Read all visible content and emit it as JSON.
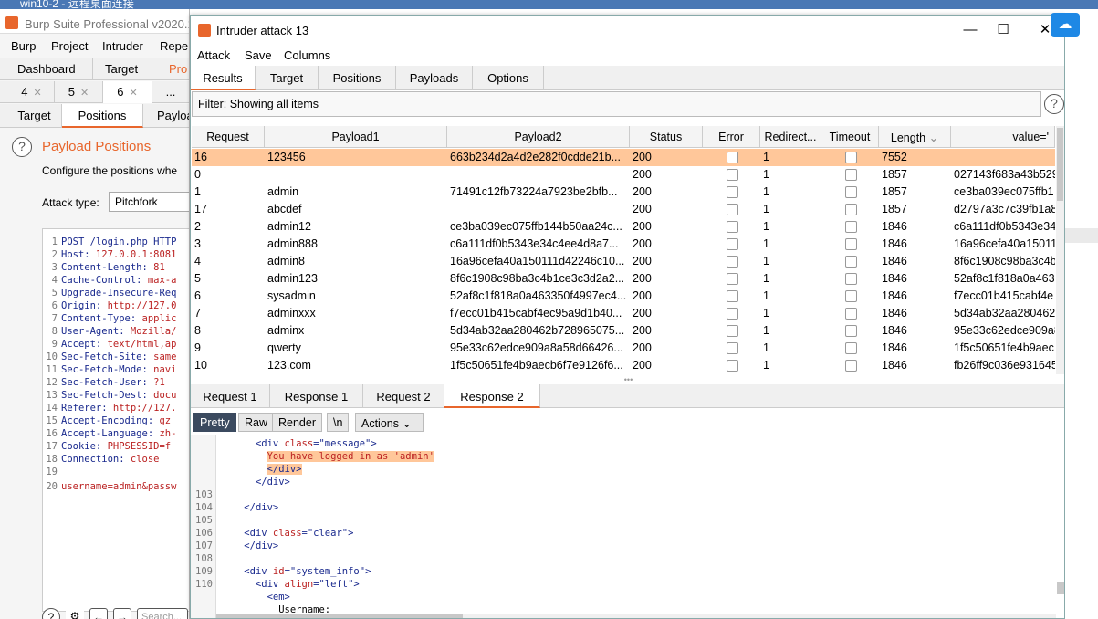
{
  "rdp": {
    "title": "win10-2 - 远程桌面连接"
  },
  "burp": {
    "title": "Burp Suite Professional v2020.1",
    "menu": [
      "Burp",
      "Project",
      "Intruder",
      "Repe"
    ],
    "top_tabs": [
      "Dashboard",
      "Target",
      "Pro"
    ],
    "num_tabs": [
      "4",
      "5",
      "6",
      "..."
    ],
    "sub_tabs": [
      "Target",
      "Positions",
      "Payloa"
    ],
    "positions_title": "Payload Positions",
    "positions_desc": "Configure the positions whe",
    "attack_type_label": "Attack type:",
    "attack_type_value": "Pitchfork",
    "request_lines": [
      {
        "n": "1",
        "key": "POST /login.php HTTP",
        "val": ""
      },
      {
        "n": "2",
        "key": "Host:",
        "val": " 127.0.0.1:8081"
      },
      {
        "n": "3",
        "key": "Content-Length:",
        "val": " 81"
      },
      {
        "n": "4",
        "key": "Cache-Control:",
        "val": " max-a"
      },
      {
        "n": "5",
        "key": "Upgrade-Insecure-Req",
        "val": ""
      },
      {
        "n": "6",
        "key": "Origin:",
        "val": " http://127.0"
      },
      {
        "n": "7",
        "key": "Content-Type:",
        "val": " applic"
      },
      {
        "n": "8",
        "key": "User-Agent:",
        "val": " Mozilla/"
      },
      {
        "n": "9",
        "key": "Accept:",
        "val": " text/html,ap"
      },
      {
        "n": "10",
        "key": "Sec-Fetch-Site:",
        "val": " same"
      },
      {
        "n": "11",
        "key": "Sec-Fetch-Mode:",
        "val": " navi"
      },
      {
        "n": "12",
        "key": "Sec-Fetch-User:",
        "val": " ?1"
      },
      {
        "n": "13",
        "key": "Sec-Fetch-Dest:",
        "val": " docu"
      },
      {
        "n": "14",
        "key": "Referer:",
        "val": " http://127."
      },
      {
        "n": "15",
        "key": "Accept-Encoding:",
        "val": " gz"
      },
      {
        "n": "16",
        "key": "Accept-Language:",
        "val": " zh-"
      },
      {
        "n": "17",
        "key": "Cookie:",
        "val": " PHPSESSID=f"
      },
      {
        "n": "18",
        "key": "Connection:",
        "val": " close"
      },
      {
        "n": "19",
        "key": "",
        "val": ""
      },
      {
        "n": "20",
        "key": "username=admin&passw",
        "val": ""
      }
    ],
    "search_placeholder": "Search..."
  },
  "window": {
    "title": "Intruder attack 13",
    "menu": [
      "Attack",
      "Save",
      "Columns"
    ],
    "tabs": [
      "Results",
      "Target",
      "Positions",
      "Payloads",
      "Options"
    ],
    "filter_text": "Filter: Showing all items",
    "columns": [
      "Request",
      "Payload1",
      "Payload2",
      "Status",
      "Error",
      "Redirect...",
      "Timeout",
      "Length",
      "value='"
    ],
    "rows": [
      {
        "request": "16",
        "p1": "123456",
        "p2": "663b234d2a4d2e282f0cdde21b...",
        "status": "200",
        "redirect": "1",
        "length": "7552",
        "value": "",
        "selected": true
      },
      {
        "request": "0",
        "p1": "",
        "p2": "",
        "status": "200",
        "redirect": "1",
        "length": "1857",
        "value": "027143f683a43b529"
      },
      {
        "request": "1",
        "p1": "admin",
        "p2": "71491c12fb73224a7923be2bfb...",
        "status": "200",
        "redirect": "1",
        "length": "1857",
        "value": "ce3ba039ec075ffb1"
      },
      {
        "request": "17",
        "p1": "abcdef",
        "p2": "",
        "status": "200",
        "redirect": "1",
        "length": "1857",
        "value": "d2797a3c7c39fb1a8"
      },
      {
        "request": "2",
        "p1": "admin12",
        "p2": "ce3ba039ec075ffb144b50aa24c...",
        "status": "200",
        "redirect": "1",
        "length": "1846",
        "value": "c6a111df0b5343e34"
      },
      {
        "request": "3",
        "p1": "admin888",
        "p2": "c6a111df0b5343e34c4ee4d8a7...",
        "status": "200",
        "redirect": "1",
        "length": "1846",
        "value": "16a96cefa40a15011"
      },
      {
        "request": "4",
        "p1": "admin8",
        "p2": "16a96cefa40a150111d42246c10...",
        "status": "200",
        "redirect": "1",
        "length": "1846",
        "value": "8f6c1908c98ba3c4b"
      },
      {
        "request": "5",
        "p1": "admin123",
        "p2": "8f6c1908c98ba3c4b1ce3c3d2a2...",
        "status": "200",
        "redirect": "1",
        "length": "1846",
        "value": "52af8c1f818a0a463"
      },
      {
        "request": "6",
        "p1": "sysadmin",
        "p2": "52af8c1f818a0a463350f4997ec4...",
        "status": "200",
        "redirect": "1",
        "length": "1846",
        "value": "f7ecc01b415cabf4e"
      },
      {
        "request": "7",
        "p1": "adminxxx",
        "p2": "f7ecc01b415cabf4ec95a9d1b40...",
        "status": "200",
        "redirect": "1",
        "length": "1846",
        "value": "5d34ab32aa280462"
      },
      {
        "request": "8",
        "p1": "adminx",
        "p2": "5d34ab32aa280462b728965075...",
        "status": "200",
        "redirect": "1",
        "length": "1846",
        "value": "95e33c62edce909a8"
      },
      {
        "request": "9",
        "p1": "qwerty",
        "p2": "95e33c62edce909a8a58d66426...",
        "status": "200",
        "redirect": "1",
        "length": "1846",
        "value": "1f5c50651fe4b9aec"
      },
      {
        "request": "10",
        "p1": "123.com",
        "p2": "1f5c50651fe4b9aecb6f7e9126f6...",
        "status": "200",
        "redirect": "1",
        "length": "1846",
        "value": "fb26ff9c036e931645"
      }
    ],
    "resp_tabs": [
      "Request 1",
      "Response 1",
      "Request 2",
      "Response 2"
    ],
    "view_buttons": [
      "Pretty",
      "Raw",
      "Render",
      "\\n",
      "Actions"
    ],
    "code_lines": [
      {
        "n": "",
        "indent": "      ",
        "parts": [
          [
            "tag",
            "<div "
          ],
          [
            "atn",
            "class"
          ],
          [
            "tag",
            "="
          ],
          [
            "atv",
            "\"message\""
          ],
          [
            "tag",
            ">"
          ]
        ]
      },
      {
        "n": "",
        "indent": "        ",
        "parts": [
          [
            "hl",
            "You have logged in as 'admin'"
          ]
        ]
      },
      {
        "n": "",
        "indent": "        ",
        "parts": [
          [
            "hltag",
            "</div>"
          ]
        ]
      },
      {
        "n": "",
        "indent": "      ",
        "parts": [
          [
            "tag",
            "</div>"
          ]
        ]
      },
      {
        "n": "103",
        "indent": "",
        "parts": []
      },
      {
        "n": "104",
        "indent": "    ",
        "parts": [
          [
            "tag",
            "</div>"
          ]
        ]
      },
      {
        "n": "105",
        "indent": "",
        "parts": []
      },
      {
        "n": "106",
        "indent": "    ",
        "parts": [
          [
            "tag",
            "<div "
          ],
          [
            "atn",
            "class"
          ],
          [
            "tag",
            "="
          ],
          [
            "atv",
            "\"clear\""
          ],
          [
            "tag",
            ">"
          ]
        ]
      },
      {
        "n": "107",
        "indent": "    ",
        "parts": [
          [
            "tag",
            "</div>"
          ]
        ]
      },
      {
        "n": "108",
        "indent": "",
        "parts": []
      },
      {
        "n": "109",
        "indent": "    ",
        "parts": [
          [
            "tag",
            "<div "
          ],
          [
            "atn",
            "id"
          ],
          [
            "tag",
            "="
          ],
          [
            "atv",
            "\"system_info\""
          ],
          [
            "tag",
            ">"
          ]
        ]
      },
      {
        "n": "110",
        "indent": "      ",
        "parts": [
          [
            "tag",
            "<div "
          ],
          [
            "atn",
            "align"
          ],
          [
            "tag",
            "="
          ],
          [
            "atv",
            "\"left\""
          ],
          [
            "tag",
            ">"
          ]
        ]
      },
      {
        "n": "",
        "indent": "        ",
        "parts": [
          [
            "tag",
            "<em>"
          ]
        ]
      },
      {
        "n": "",
        "indent": "          ",
        "parts": [
          [
            "plain",
            "Username:"
          ]
        ]
      }
    ],
    "colors": {
      "accent": "#e8662c",
      "selected_row": "#ffc79a",
      "pretty_active": "#3b4a5f"
    }
  }
}
